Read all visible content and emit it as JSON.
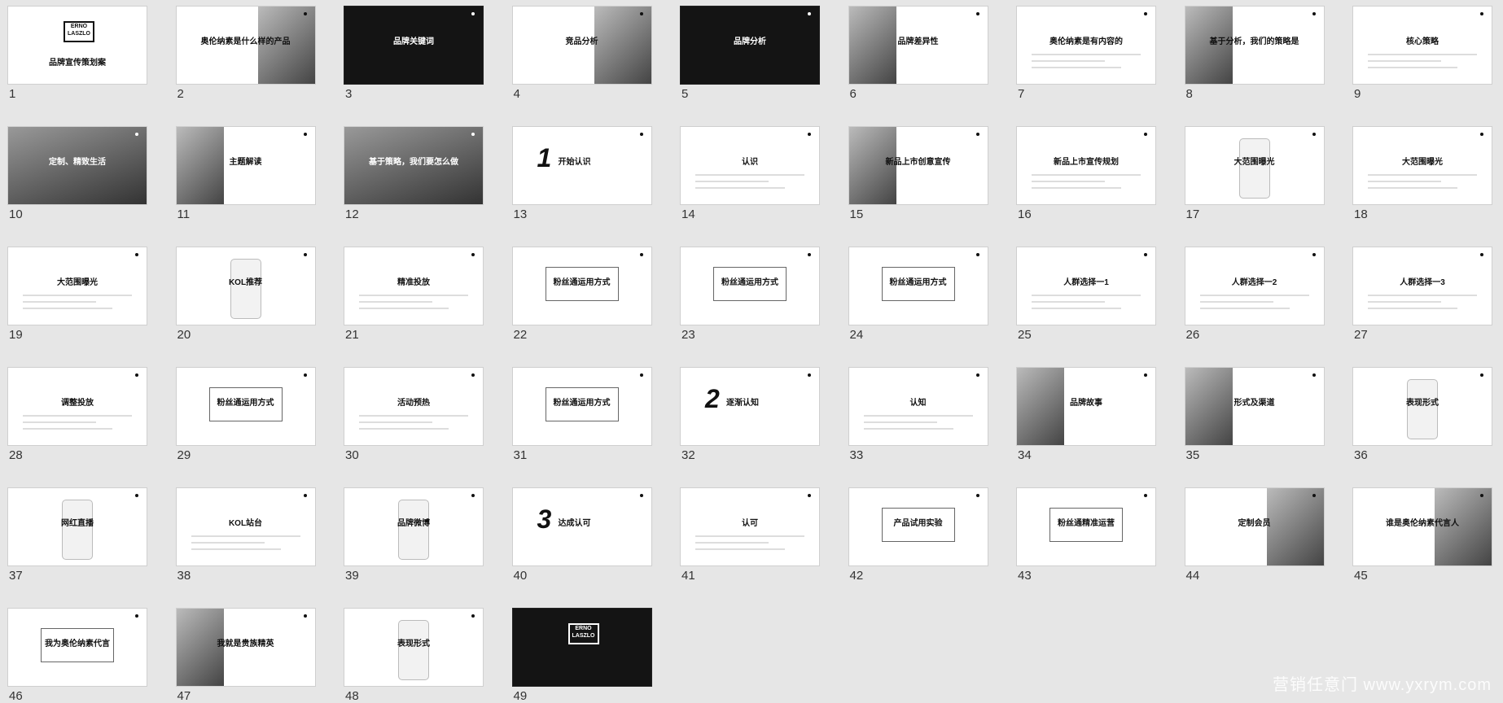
{
  "slides": [
    {
      "num": "1",
      "title": "品牌宣传策划案",
      "theme": "logo"
    },
    {
      "num": "2",
      "title": "奥伦纳素是什么样的产品",
      "theme": "photo-right"
    },
    {
      "num": "3",
      "title": "品牌关键词",
      "theme": "dark"
    },
    {
      "num": "4",
      "title": "竞品分析",
      "theme": "photo-right"
    },
    {
      "num": "5",
      "title": "品牌分析",
      "theme": "dark"
    },
    {
      "num": "6",
      "title": "品牌差异性",
      "theme": "photo-left"
    },
    {
      "num": "7",
      "title": "奥伦纳素是有内容的",
      "theme": "plain"
    },
    {
      "num": "8",
      "title": "基于分析，我们的策略是",
      "theme": "photo-left"
    },
    {
      "num": "9",
      "title": "核心策略",
      "theme": "icons"
    },
    {
      "num": "10",
      "title": "定制、精致生活",
      "theme": "mid"
    },
    {
      "num": "11",
      "title": "主题解读",
      "theme": "photo-left"
    },
    {
      "num": "12",
      "title": "基于策略，我们要怎么做",
      "theme": "mid"
    },
    {
      "num": "13",
      "title": "开始认识",
      "theme": "big",
      "big": "1"
    },
    {
      "num": "14",
      "title": "认识",
      "theme": "plain"
    },
    {
      "num": "15",
      "title": "新品上市创意宣传",
      "theme": "photo-left"
    },
    {
      "num": "16",
      "title": "新品上市宣传规划",
      "theme": "plain"
    },
    {
      "num": "17",
      "title": "大范围曝光",
      "theme": "phone"
    },
    {
      "num": "18",
      "title": "大范围曝光",
      "theme": "plain"
    },
    {
      "num": "19",
      "title": "大范围曝光",
      "theme": "plain"
    },
    {
      "num": "20",
      "title": "KOL推荐",
      "theme": "phone"
    },
    {
      "num": "21",
      "title": "精准投放",
      "theme": "plain"
    },
    {
      "num": "22",
      "title": "粉丝通运用方式",
      "theme": "box"
    },
    {
      "num": "23",
      "title": "粉丝通运用方式",
      "theme": "box"
    },
    {
      "num": "24",
      "title": "粉丝通运用方式",
      "theme": "box"
    },
    {
      "num": "25",
      "title": "人群选择一1",
      "theme": "plain"
    },
    {
      "num": "26",
      "title": "人群选择一2",
      "theme": "plain"
    },
    {
      "num": "27",
      "title": "人群选择一3",
      "theme": "plain"
    },
    {
      "num": "28",
      "title": "调整投放",
      "theme": "plain"
    },
    {
      "num": "29",
      "title": "粉丝通运用方式",
      "theme": "box"
    },
    {
      "num": "30",
      "title": "活动预热",
      "theme": "plain"
    },
    {
      "num": "31",
      "title": "粉丝通运用方式",
      "theme": "box"
    },
    {
      "num": "32",
      "title": "逐渐认知",
      "theme": "big",
      "big": "2"
    },
    {
      "num": "33",
      "title": "认知",
      "theme": "plain"
    },
    {
      "num": "34",
      "title": "品牌故事",
      "theme": "photo-left"
    },
    {
      "num": "35",
      "title": "形式及渠道",
      "theme": "photo-left"
    },
    {
      "num": "36",
      "title": "表现形式",
      "theme": "phone"
    },
    {
      "num": "37",
      "title": "网红直播",
      "theme": "phone"
    },
    {
      "num": "38",
      "title": "KOL站台",
      "theme": "plain"
    },
    {
      "num": "39",
      "title": "品牌微博",
      "theme": "phone"
    },
    {
      "num": "40",
      "title": "达成认可",
      "theme": "big",
      "big": "3"
    },
    {
      "num": "41",
      "title": "认可",
      "theme": "plain"
    },
    {
      "num": "42",
      "title": "产品试用实验",
      "theme": "box"
    },
    {
      "num": "43",
      "title": "粉丝通精准运营",
      "theme": "box"
    },
    {
      "num": "44",
      "title": "定制会员",
      "theme": "photo-right"
    },
    {
      "num": "45",
      "title": "谁是奥伦纳素代言人",
      "theme": "photo-right"
    },
    {
      "num": "46",
      "title": "我为奥伦纳素代言",
      "theme": "box"
    },
    {
      "num": "47",
      "title": "我就是贵族精英",
      "theme": "photo-left"
    },
    {
      "num": "48",
      "title": "表现形式",
      "theme": "phone"
    },
    {
      "num": "49",
      "title": "",
      "theme": "dark-logo"
    }
  ],
  "logo_text": "ERNO LASZLO",
  "watermark": "营销任意门 www.yxrym.com"
}
